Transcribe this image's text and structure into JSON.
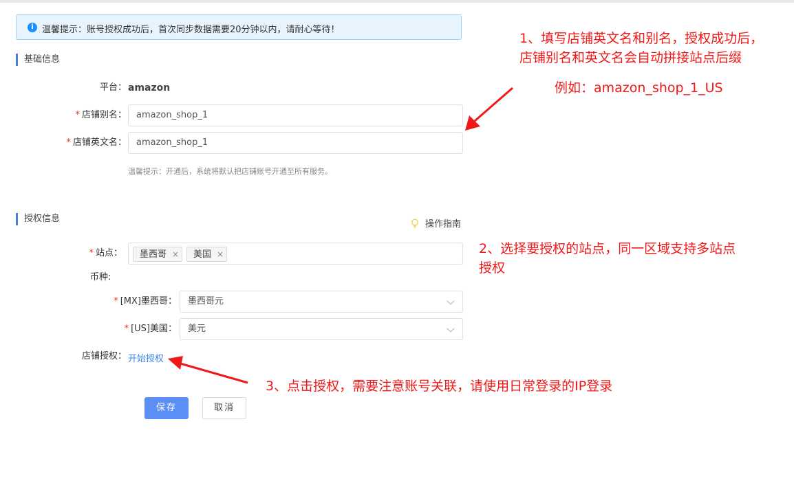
{
  "notice": {
    "icon": "info-icon",
    "text": "温馨提示：账号授权成功后，首次同步数据需要20分钟以内，请耐心等待！"
  },
  "basic": {
    "section_title": "基础信息",
    "platform_label": "平台：",
    "platform_value": "amazon",
    "alias_label": "店铺别名：",
    "alias_value": "amazon_shop_1",
    "english_label": "店铺英文名：",
    "english_value": "amazon_shop_1",
    "hint": "温馨提示：开通后，系统将默认把店铺账号开通至所有服务。"
  },
  "auth": {
    "section_title": "授权信息",
    "guide_label": "操作指南",
    "sites_label": "站点：",
    "sites": [
      {
        "label": "墨西哥",
        "close": "×"
      },
      {
        "label": "美国",
        "close": "×"
      }
    ],
    "currency_label": "币种:",
    "currencies": [
      {
        "label": "[MX]墨西哥：",
        "value": "墨西哥元"
      },
      {
        "label": "[US]美国：",
        "value": "美元"
      }
    ],
    "store_auth_label": "店铺授权：",
    "store_auth_link": "开始授权"
  },
  "required_mark": "*",
  "actions": {
    "save": "保存",
    "cancel": "取消"
  },
  "annotations": {
    "step1_line1": "1、填写店铺英文名和别名，授权成功后，",
    "step1_line2": "店铺别名和英文名会自动拼接站点后缀",
    "step1_example": "例如：amazon_shop_1_US",
    "step2_line1": "2、选择要授权的站点，同一区域支持多站点",
    "step2_line2": "授权",
    "step3": "3、点击授权，需要注意账号关联，请使用日常登录的IP登录"
  },
  "colors": {
    "accent": "#4a7fe0",
    "primary_button": "#5b8ff5",
    "link": "#3f86ec",
    "required": "#e5342d",
    "annotation": "#f01818",
    "notice_bg": "#e8f4fd"
  }
}
